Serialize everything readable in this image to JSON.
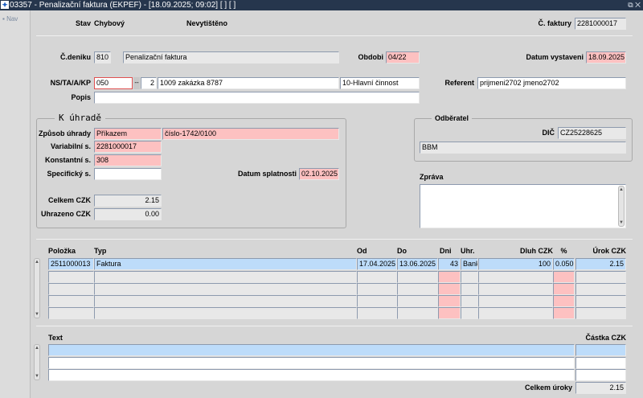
{
  "window": {
    "title": "03357 - Penalizační faktura (EKPEF) - [18.09.2025; 09:02]  [ ]  [ ]",
    "controls": "⧉ ✕"
  },
  "nav": {
    "label": "Nav"
  },
  "header": {
    "stav_label": "Stav",
    "stav_value": "Chybový",
    "print_status": "Nevytištěno",
    "faktura_label": "Č. faktury",
    "faktura_value": "2281000017"
  },
  "doc": {
    "denik_label": "Č.deniku",
    "denik_value": "810",
    "denik_name": "Penalizační faktura",
    "obdobi_label": "Obdobi",
    "obdobi_value": "04/22",
    "datum_vyst_label": "Datum vystaveni",
    "datum_vyst_value": "18.09.2025",
    "ns_label": "NS/TA/A/KP",
    "ns_value": "050",
    "ns_btn": "--",
    "ta_value": "2",
    "zakazka_value": "1009 zakázka 8787",
    "cinnost_value": "10-Hlavní činnost",
    "referent_label": "Referent",
    "referent_value": "prijmeni2702 jmeno2702",
    "popis_label": "Popis",
    "popis_value": ""
  },
  "payment": {
    "title": "K úhradě",
    "zpusob_label": "Způsob úhrady",
    "zpusob_value": "Příkazem",
    "ucet_value": "číslo-1742/0100",
    "vs_label": "Variabilní s.",
    "vs_value": "2281000017",
    "ks_label": "Konstantní s.",
    "ks_value": "308",
    "ss_label": "Specifický s.",
    "ss_value": "",
    "splatnost_label": "Datum splatnosti",
    "splatnost_value": "02.10.2025",
    "celkem_label": "Celkem CZK",
    "celkem_value": "2.15",
    "uhrazeno_label": "Uhrazeno CZK",
    "uhrazeno_value": "0.00"
  },
  "customer": {
    "title": "Odběratel",
    "dic_label": "DIČ",
    "dic_value": "CZ25228625",
    "name_value": "BBM",
    "zprava_label": "Zpráva",
    "zprava_value": ""
  },
  "items": {
    "headers": [
      "Položka",
      "Typ",
      "Od",
      "Do",
      "Dni",
      "Uhr.",
      "Dluh CZK",
      "%",
      "Úrok CZK"
    ],
    "rows": [
      [
        "2511000013",
        "Faktura",
        "17.04.2025",
        "13.06.2025",
        "43",
        "Bank",
        "100",
        "0.050",
        "2.15"
      ],
      [
        "",
        "",
        "",
        "",
        "",
        "",
        "",
        "",
        ""
      ],
      [
        "",
        "",
        "",
        "",
        "",
        "",
        "",
        "",
        ""
      ],
      [
        "",
        "",
        "",
        "",
        "",
        "",
        "",
        "",
        ""
      ],
      [
        "",
        "",
        "",
        "",
        "",
        "",
        "",
        "",
        ""
      ]
    ]
  },
  "texts": {
    "headers": [
      "Text",
      "Částka CZK"
    ],
    "rows": [
      [
        "",
        ""
      ],
      [
        "",
        ""
      ],
      [
        "",
        ""
      ]
    ],
    "total_label": "Celkem úroky",
    "total_value": "2.15"
  }
}
